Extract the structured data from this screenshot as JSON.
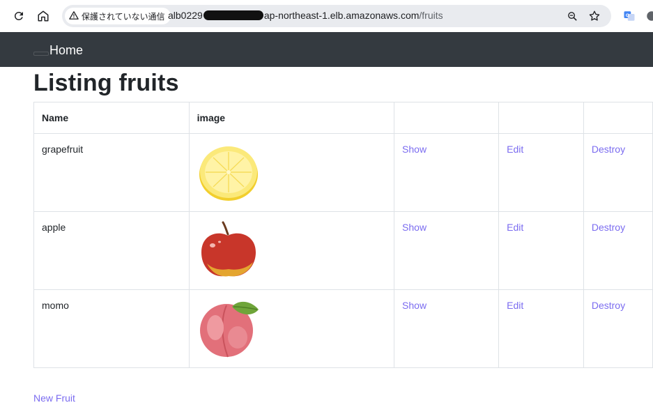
{
  "browser": {
    "security_label": "保護されていない通信",
    "url_prefix": "alb0229",
    "url_host_suffix": "ap-northeast-1.elb.amazonaws.com",
    "url_path": "/fruits"
  },
  "navbar": {
    "home_label": "Home"
  },
  "page": {
    "title": "Listing fruits"
  },
  "table": {
    "headers": [
      "Name",
      "image",
      "",
      "",
      ""
    ],
    "rows": [
      {
        "name": "grapefruit",
        "image_icon": "lemon-slice-illustration",
        "show": "Show",
        "edit": "Edit",
        "destroy": "Destroy"
      },
      {
        "name": "apple",
        "image_icon": "apple-illustration",
        "show": "Show",
        "edit": "Edit",
        "destroy": "Destroy"
      },
      {
        "name": "momo",
        "image_icon": "peach-illustration",
        "show": "Show",
        "edit": "Edit",
        "destroy": "Destroy"
      }
    ]
  },
  "actions": {
    "new_label": "New Fruit"
  },
  "colors": {
    "navbar_bg": "#343a40",
    "link": "#7b6cf0",
    "border": "#dee2e6"
  }
}
